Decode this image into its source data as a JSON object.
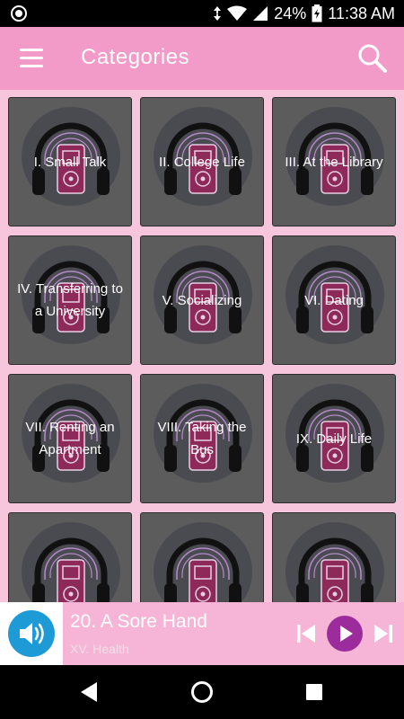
{
  "status_bar": {
    "battery": "24%",
    "time": "11:38 AM"
  },
  "app_bar": {
    "title": "Categories",
    "menu_icon": "menu-icon",
    "search_icon": "search-icon"
  },
  "categories": [
    {
      "label": "I. Small Talk"
    },
    {
      "label": "II. College Life"
    },
    {
      "label": "III. At the Library"
    },
    {
      "label": "IV. Transferring to a University"
    },
    {
      "label": "V. Socializing"
    },
    {
      "label": "VI. Dating"
    },
    {
      "label": "VII. Renting an Apartment"
    },
    {
      "label": "VIII. Taking the Bus"
    },
    {
      "label": "IX. Daily Life"
    },
    {
      "label": ""
    },
    {
      "label": ""
    },
    {
      "label": ""
    }
  ],
  "player": {
    "title": "20. A Sore Hand",
    "category": "XV. Health"
  },
  "colors": {
    "app_bar": "#f29bc8",
    "background": "#f7c6dd",
    "tile": "#5c5c5c",
    "play_button": "#9c2c9c",
    "volume_button": "#1e9ad6",
    "player_bar": "#f6b5d6"
  }
}
